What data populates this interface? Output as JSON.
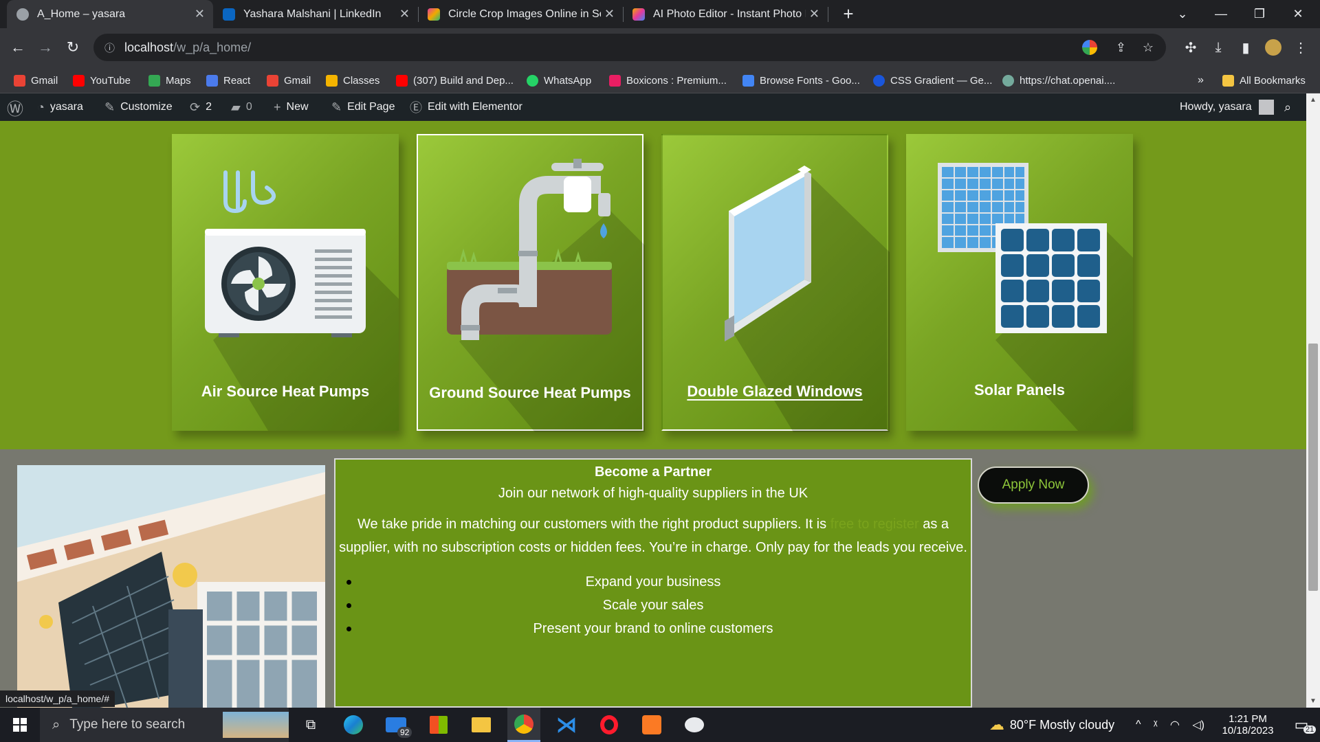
{
  "browser": {
    "tabs": [
      {
        "title": "A_Home – yasara",
        "active": true,
        "color": "#9aa0a6"
      },
      {
        "title": "Yashara Malshani | LinkedIn",
        "active": false,
        "color": "#0a66c2"
      },
      {
        "title": "Circle Crop Images Online in Sec",
        "active": false,
        "color": "#e5399c"
      },
      {
        "title": "AI Photo Editor - Instant Photo E",
        "active": false,
        "color": "#f2a900"
      }
    ],
    "new_tab": "+",
    "url_host": "localhost",
    "url_path": "/w_p/a_home/",
    "bookmarks": [
      {
        "label": "Gmail",
        "color": "#ea4335"
      },
      {
        "label": "YouTube",
        "color": "#ff0000"
      },
      {
        "label": "Maps",
        "color": "#34a853"
      },
      {
        "label": "React",
        "color": "#4b7bec"
      },
      {
        "label": "Gmail",
        "color": "#ea4335"
      },
      {
        "label": "Classes",
        "color": "#f4b400"
      },
      {
        "label": "(307) Build and Dep...",
        "color": "#ff0000"
      },
      {
        "label": "WhatsApp",
        "color": "#25d366"
      },
      {
        "label": "Boxicons : Premium...",
        "color": "#e91e63"
      },
      {
        "label": "Browse Fonts - Goo...",
        "color": "#4285f4"
      },
      {
        "label": "CSS Gradient — Ge...",
        "color": "#1a56db"
      },
      {
        "label": "https://chat.openai....",
        "color": "#74aa9c"
      }
    ],
    "bookmarks_more": "»",
    "all_bookmarks": "All Bookmarks",
    "status_url": "localhost/w_p/a_home/#"
  },
  "wp_admin": {
    "site": "yasara",
    "customize": "Customize",
    "revisions": "2",
    "comments": "0",
    "new": "New",
    "edit_page": "Edit Page",
    "elementor": "Edit with Elementor",
    "howdy": "Howdy, yasara"
  },
  "services": [
    {
      "label": "Air Source Heat Pumps",
      "icon": "air-conditioner-icon"
    },
    {
      "label": "Ground Source Heat Pumps",
      "icon": "water-pipe-tap-icon"
    },
    {
      "label": "Double Glazed Windows",
      "icon": "window-pane-icon"
    },
    {
      "label": "Solar Panels",
      "icon": "solar-panel-icon"
    }
  ],
  "partner": {
    "heading": "Become a Partner",
    "subheading": "Join our network of high-quality suppliers in the UK",
    "para_before": "We take pride in matching our customers with the right product suppliers. It is",
    "para_hidden": "free to register",
    "para_after": "as a supplier, with no subscription costs or hidden fees. You’re in charge. Only pay for the leads you receive.",
    "bullets": [
      "Expand your business",
      "Scale your sales",
      "Present your brand to online customers"
    ],
    "apply": "Apply Now"
  },
  "taskbar": {
    "search_placeholder": "Type here to search",
    "mail_badge": "92",
    "weather": "80°F  Mostly cloudy",
    "time": "1:21 PM",
    "date": "10/18/2023",
    "notifications": "21"
  }
}
